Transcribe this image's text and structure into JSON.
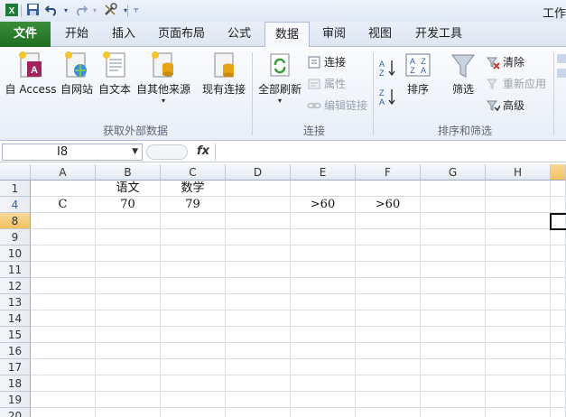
{
  "title": "工作",
  "quick_access": {
    "save_icon": "save-icon",
    "undo_icon": "undo-icon",
    "redo_icon": "redo-icon",
    "tools_icon": "tools-icon",
    "customize_icon": "customize-icon"
  },
  "tabs": [
    {
      "label": "文件"
    },
    {
      "label": "开始"
    },
    {
      "label": "插入"
    },
    {
      "label": "页面布局"
    },
    {
      "label": "公式"
    },
    {
      "label": "数据"
    },
    {
      "label": "审阅"
    },
    {
      "label": "视图"
    },
    {
      "label": "开发工具"
    }
  ],
  "ribbon": {
    "get_external": {
      "label": "获取外部数据",
      "buttons": [
        {
          "label": "自 Access"
        },
        {
          "label": "自网站"
        },
        {
          "label": "自文本"
        },
        {
          "label": "自其他来源"
        },
        {
          "label": "现有连接"
        }
      ]
    },
    "connections": {
      "label": "连接",
      "refresh_all": "全部刷新",
      "connect": "连接",
      "properties": "属性",
      "edit_links": "编辑链接"
    },
    "sort_filter": {
      "label": "排序和筛选",
      "sort": "排序",
      "filter": "筛选",
      "clear": "清除",
      "reapply": "重新应用",
      "advanced": "高级"
    }
  },
  "formula_bar": {
    "name_box": "I8",
    "fx": "fx",
    "value": ""
  },
  "columns": [
    "A",
    "B",
    "C",
    "D",
    "E",
    "F",
    "G",
    "H"
  ],
  "rows": [
    {
      "num": "1",
      "cells": [
        "",
        "语文",
        "数学",
        "",
        "",
        "",
        "",
        ""
      ]
    },
    {
      "num": "4",
      "cells": [
        "C",
        "70",
        "79",
        "",
        ">60",
        ">60",
        "",
        ""
      ]
    },
    {
      "num": "8",
      "cells": [
        "",
        "",
        "",
        "",
        "",
        "",
        "",
        ""
      ]
    },
    {
      "num": "9",
      "cells": [
        "",
        "",
        "",
        "",
        "",
        "",
        "",
        ""
      ]
    },
    {
      "num": "10",
      "cells": [
        "",
        "",
        "",
        "",
        "",
        "",
        "",
        ""
      ]
    },
    {
      "num": "11",
      "cells": [
        "",
        "",
        "",
        "",
        "",
        "",
        "",
        ""
      ]
    },
    {
      "num": "12",
      "cells": [
        "",
        "",
        "",
        "",
        "",
        "",
        "",
        ""
      ]
    },
    {
      "num": "13",
      "cells": [
        "",
        "",
        "",
        "",
        "",
        "",
        "",
        ""
      ]
    },
    {
      "num": "14",
      "cells": [
        "",
        "",
        "",
        "",
        "",
        "",
        "",
        ""
      ]
    },
    {
      "num": "15",
      "cells": [
        "",
        "",
        "",
        "",
        "",
        "",
        "",
        ""
      ]
    },
    {
      "num": "16",
      "cells": [
        "",
        "",
        "",
        "",
        "",
        "",
        "",
        ""
      ]
    },
    {
      "num": "17",
      "cells": [
        "",
        "",
        "",
        "",
        "",
        "",
        "",
        ""
      ]
    },
    {
      "num": "18",
      "cells": [
        "",
        "",
        "",
        "",
        "",
        "",
        "",
        ""
      ]
    },
    {
      "num": "19",
      "cells": [
        "",
        "",
        "",
        "",
        "",
        "",
        "",
        ""
      ]
    },
    {
      "num": "20",
      "cells": [
        "",
        "",
        "",
        "",
        "",
        "",
        "",
        ""
      ]
    }
  ]
}
